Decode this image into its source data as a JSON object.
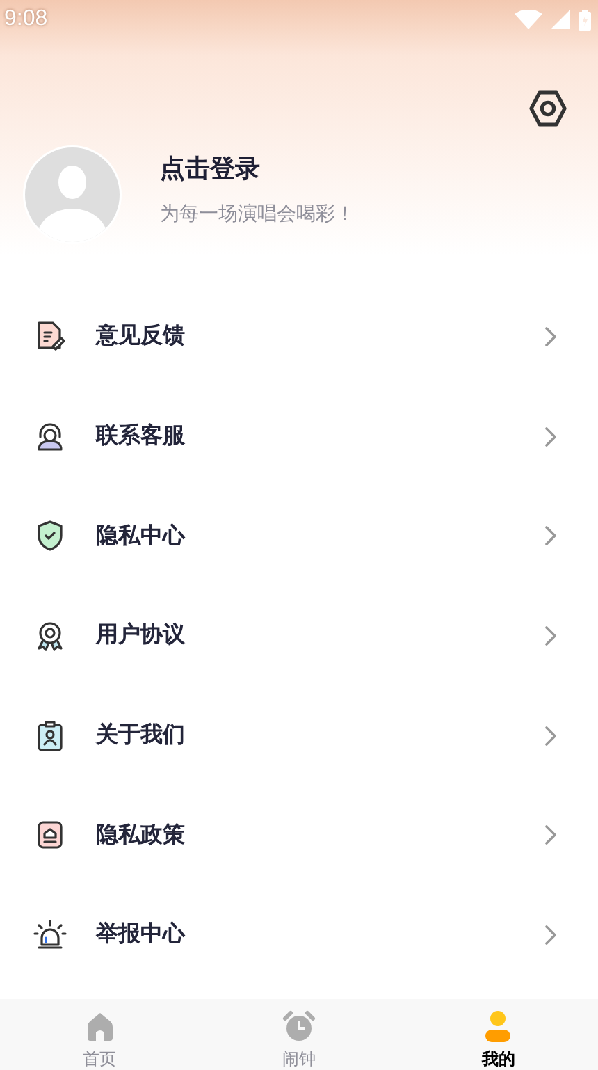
{
  "status_bar": {
    "time": "9:08"
  },
  "profile": {
    "title": "点击登录",
    "subtitle": "为每一场演唱会喝彩！"
  },
  "menu": [
    {
      "label": "意见反馈"
    },
    {
      "label": "联系客服"
    },
    {
      "label": "隐私中心"
    },
    {
      "label": "用户协议"
    },
    {
      "label": "关于我们"
    },
    {
      "label": "隐私政策"
    },
    {
      "label": "举报中心"
    }
  ],
  "tabs": [
    {
      "label": "首页",
      "selected": false
    },
    {
      "label": "闹钟",
      "selected": false
    },
    {
      "label": "我的",
      "selected": true
    }
  ]
}
